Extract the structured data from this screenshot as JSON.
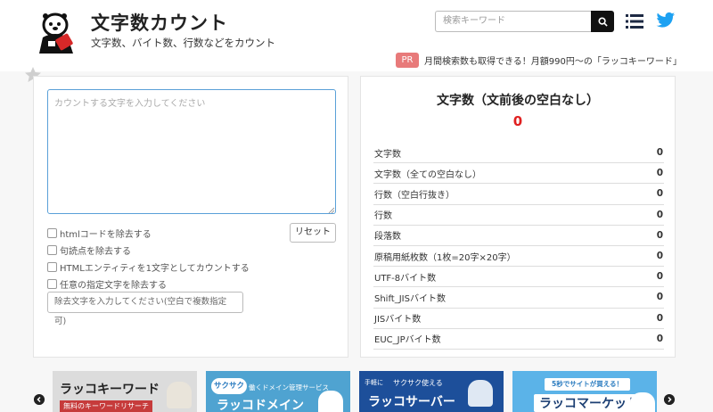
{
  "header": {
    "title": "文字数カウント",
    "subtitle": "文字数、バイト数、行数などをカウント",
    "search_placeholder": "検索キーワード",
    "pr_badge": "PR",
    "pr_text": "月間検索数も取得できる！月額990円〜の「ラッコキーワード」"
  },
  "input": {
    "placeholder": "カウントする文字を入力してください",
    "reset_label": "リセット",
    "options": [
      "htmlコードを除去する",
      "句読点を除去する",
      "HTMLエンティティを1文字としてカウントする",
      "任意の指定文字を除去する"
    ],
    "remove_placeholder": "除去文字を入力してください(空白で複数指定可)"
  },
  "result": {
    "title": "文字数（文前後の空白なし）",
    "value": "0",
    "stats": [
      {
        "label": "文字数",
        "value": "0"
      },
      {
        "label": "文字数（全ての空白なし）",
        "value": "0"
      },
      {
        "label": "行数（空白行抜き）",
        "value": "0"
      },
      {
        "label": "行数",
        "value": "0"
      },
      {
        "label": "段落数",
        "value": "0"
      },
      {
        "label": "原稿用紙枚数（1枚=20字×20字）",
        "value": "0"
      },
      {
        "label": "UTF-8バイト数",
        "value": "0"
      },
      {
        "label": "Shift_JISバイト数",
        "value": "0"
      },
      {
        "label": "JISバイト数",
        "value": "0"
      },
      {
        "label": "EUC_JPバイト数",
        "value": "0"
      }
    ]
  },
  "banners": {
    "b1": {
      "title": "ラッコキーワード",
      "sub": "無料のキーワードリサーチ"
    },
    "b2": {
      "tag": "サクサク",
      "sub": "働くドメイン管理サービス",
      "title": "ラッコドメイン"
    },
    "b3": {
      "tag": "手軽に",
      "sub": "サクサク使える",
      "title": "ラッコサーバー"
    },
    "b4": {
      "sub": "5秒でサイトが買える！",
      "title": "ラッコマーケット"
    }
  },
  "colors": {
    "accent_blue": "#5aa0d8",
    "result_red": "#e02020",
    "pr_badge": "#e87a7a",
    "twitter": "#1da1f2"
  }
}
